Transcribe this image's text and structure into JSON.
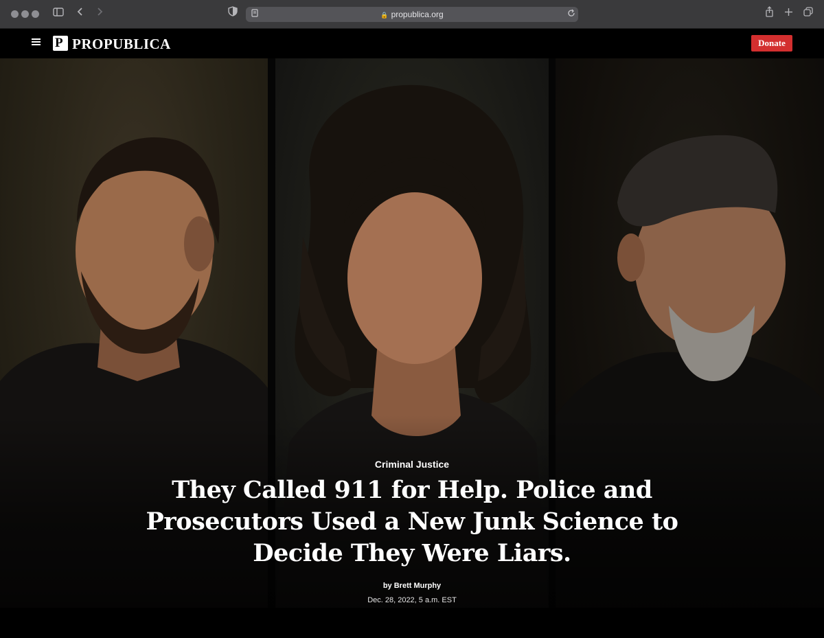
{
  "browser": {
    "url": "propublica.org",
    "icons": {
      "sidebar": "sidebar-icon",
      "back": "chevron-left-icon",
      "forward": "chevron-right-icon",
      "shield": "shield-icon",
      "reader": "reader-icon",
      "lock": "lock-icon",
      "reload": "reload-icon",
      "share": "share-icon",
      "new_tab": "plus-icon",
      "tabs": "tabs-icon"
    }
  },
  "site_header": {
    "logo_text": "PROPUBLICA",
    "donate_label": "Donate",
    "donate_color": "#d32f2f"
  },
  "article": {
    "category": "Criminal Justice",
    "headline": "They Called 911 for Help. Police and Prosecutors Used a New Junk Science to Decide They Were Liars.",
    "byline": "by Brett Murphy",
    "date": "Dec. 28, 2022, 5 a.m. EST"
  }
}
